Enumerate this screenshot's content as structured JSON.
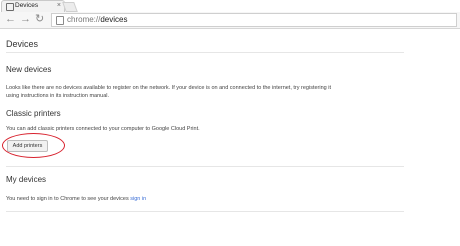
{
  "tab": {
    "title": "Devices",
    "close": "×"
  },
  "toolbar": {
    "back_icon": "←",
    "forward_icon": "→",
    "reload_icon": "↻",
    "url_scheme": "chrome://",
    "url_path": "devices"
  },
  "page": {
    "title": "Devices"
  },
  "new_devices": {
    "heading": "New devices",
    "line1": "Looks like there are no devices available to register on the network. If your device is on and connected to the internet, try registering it",
    "line2": "using instructions in its instruction manual."
  },
  "classic_printers": {
    "heading": "Classic printers",
    "description": "You can add classic printers connected to your computer to Google Cloud Print.",
    "button": "Add printers"
  },
  "my_devices": {
    "heading": "My devices",
    "text": "You need to sign in to Chrome to see your devices",
    "link": "sign in"
  },
  "colors": {
    "highlight": "#d8222e",
    "link": "#3b6ed6"
  }
}
